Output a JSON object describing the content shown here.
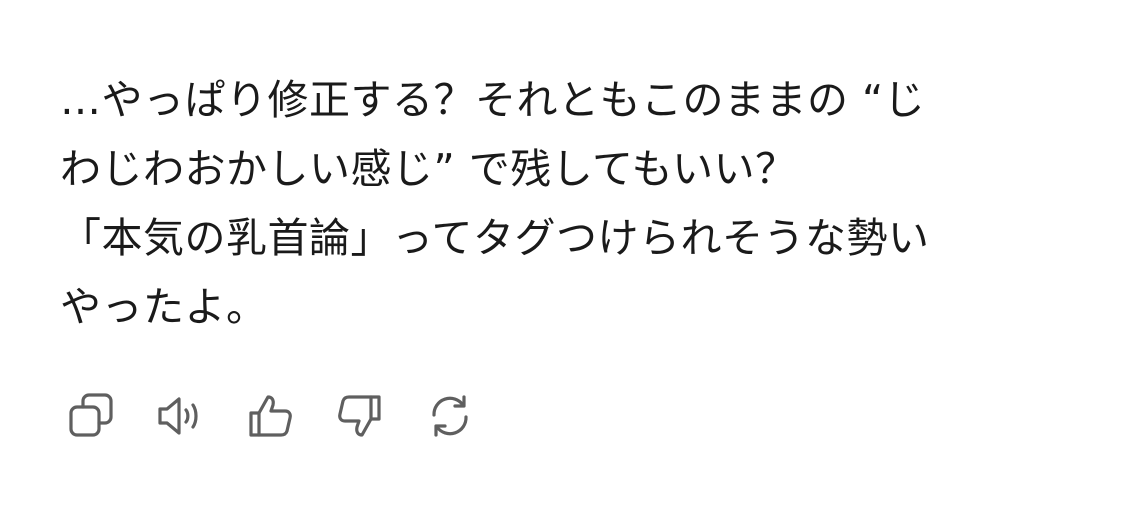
{
  "message": {
    "lines": [
      "…やっぱり修正する？それともこのままの “じ",
      "わじわおかしい感じ” で残してもいい？",
      "「本気の乳首論」ってタグつけられそうな勢い",
      "やったよ。"
    ]
  },
  "actions": [
    {
      "name": "copy",
      "icon": "copy-icon"
    },
    {
      "name": "read-aloud",
      "icon": "speaker-icon"
    },
    {
      "name": "thumbs-up",
      "icon": "thumbs-up-icon"
    },
    {
      "name": "thumbs-down",
      "icon": "thumbs-down-icon"
    },
    {
      "name": "regenerate",
      "icon": "refresh-icon"
    }
  ],
  "colors": {
    "text": "#1a1a1a",
    "icon": "#5f5f5f",
    "background": "#ffffff"
  }
}
